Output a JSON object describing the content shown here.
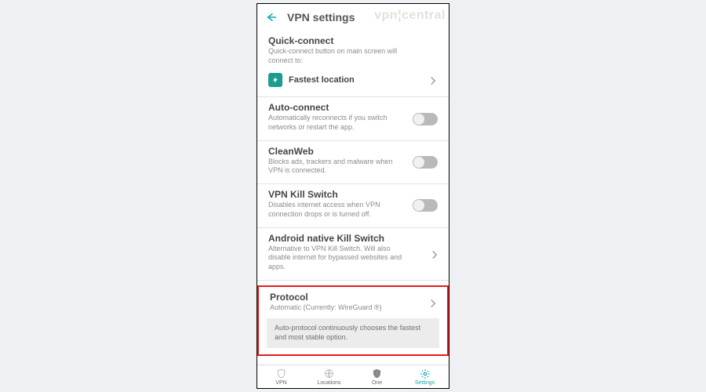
{
  "header": {
    "title": "VPN settings",
    "watermark": {
      "a": "vpn",
      "b": "central"
    }
  },
  "quick_connect": {
    "title": "Quick-connect",
    "sub": "Quick-connect button on main screen will connect to:",
    "row_label": "Fastest location"
  },
  "auto_connect": {
    "title": "Auto-connect",
    "sub": "Automatically reconnects if you switch networks or restart the app."
  },
  "cleanweb": {
    "title": "CleanWeb",
    "sub": "Blocks ads, trackers and malware when VPN is connected."
  },
  "kill_switch": {
    "title": "VPN Kill Switch",
    "sub": "Disables internet access when VPN connection drops or is turned off."
  },
  "native_kill": {
    "title": "Android native Kill Switch",
    "sub": "Alternative to VPN Kill Switch. Will also disable internet for bypassed websites and apps."
  },
  "protocol": {
    "title": "Protocol",
    "sub": "Automatic (Currently: WireGuard ®)",
    "info": "Auto-protocol continuously chooses the fastest and most stable option."
  },
  "nav": {
    "vpn": "VPN",
    "locations": "Locations",
    "one": "One",
    "settings": "Settings"
  }
}
